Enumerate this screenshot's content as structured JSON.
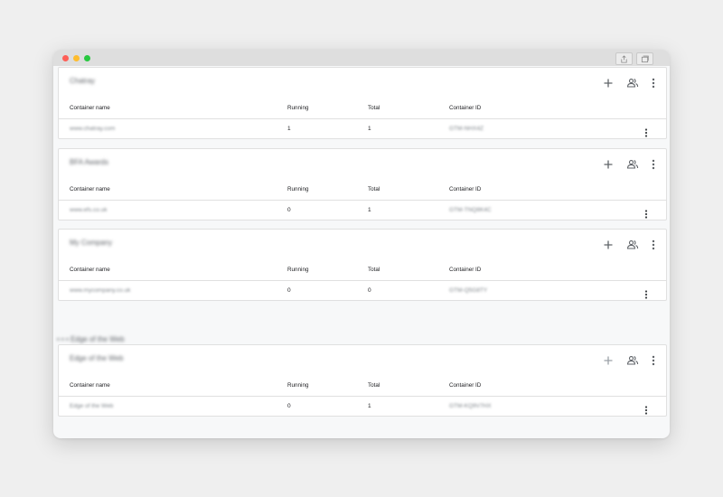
{
  "window": {
    "controls": [
      "close",
      "minimize",
      "zoom"
    ],
    "toolbar_icons": [
      "share-icon",
      "tabs-icon"
    ]
  },
  "columns": {
    "name": "Container name",
    "running": "Running",
    "total": "Total",
    "id": "Container ID"
  },
  "accounts": [
    {
      "name": "Chatray",
      "rows": [
        {
          "container_name": "www.chatray.com",
          "running": "1",
          "total": "1",
          "container_id": "GTM-NHX4Z"
        }
      ]
    },
    {
      "name": "BFA Awards",
      "rows": [
        {
          "container_name": "www.efs.co.uk",
          "running": "0",
          "total": "1",
          "container_id": "GTM-TNQ8K4C"
        }
      ]
    },
    {
      "name": "My Company",
      "rows": [
        {
          "container_name": "www.mycompany.co.uk",
          "running": "0",
          "total": "0",
          "container_id": "GTM-Q5G8TY"
        }
      ]
    },
    {
      "name": "Edge of the Web",
      "rows": [
        {
          "container_name": "Edge of the Web",
          "running": "0",
          "total": "1",
          "container_id": "GTM-KQ9V7HX"
        }
      ]
    }
  ],
  "section_heading": "• • • Edge of the Web",
  "icons": {
    "add": "add-container-icon",
    "share": "manage-users-icon",
    "more": "more-vert-icon"
  }
}
